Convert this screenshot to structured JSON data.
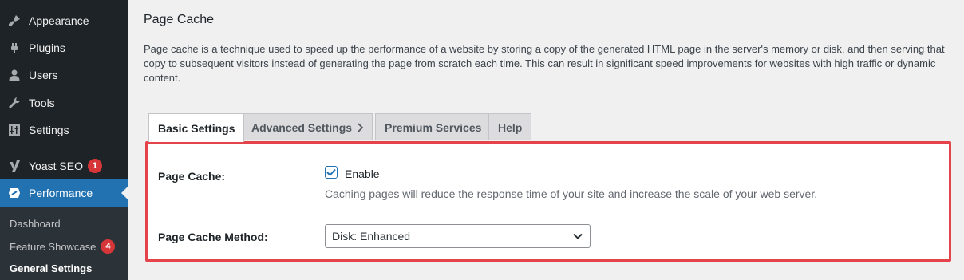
{
  "sidebar": {
    "items": [
      {
        "label": "Appearance",
        "icon": "paintbrush-icon"
      },
      {
        "label": "Plugins",
        "icon": "plugin-icon"
      },
      {
        "label": "Users",
        "icon": "user-icon"
      },
      {
        "label": "Tools",
        "icon": "wrench-icon"
      },
      {
        "label": "Settings",
        "icon": "sliders-icon"
      },
      {
        "label": "Yoast SEO",
        "icon": "yoast-icon",
        "badge": "1"
      },
      {
        "label": "Performance",
        "icon": "performance-icon"
      }
    ],
    "submenu": [
      {
        "label": "Dashboard"
      },
      {
        "label": "Feature Showcase",
        "badge": "4"
      },
      {
        "label": "General Settings"
      }
    ]
  },
  "page": {
    "title": "Page Cache",
    "description": "Page cache is a technique used to speed up the performance of a website by storing a copy of the generated HTML page in the server's memory or disk, and then serving that copy to subsequent visitors instead of generating the page from scratch each time. This can result in significant speed improvements for websites with high traffic or dynamic content."
  },
  "tabs": [
    {
      "label": "Basic Settings",
      "active": true
    },
    {
      "label": "Advanced Settings",
      "active": false
    },
    {
      "label": "Premium Services",
      "active": false
    },
    {
      "label": "Help",
      "active": false
    }
  ],
  "settings": {
    "page_cache_label": "Page Cache:",
    "enable_label": "Enable",
    "enable_checked": true,
    "help_text": "Caching pages will reduce the response time of your site and increase the scale of your web server.",
    "method_label": "Page Cache Method:",
    "method_value": "Disk: Enhanced"
  },
  "colors": {
    "sidebar_bg": "#1d2327",
    "accent": "#2271b1",
    "badge": "#d63638",
    "highlight_border": "#e5434c"
  }
}
